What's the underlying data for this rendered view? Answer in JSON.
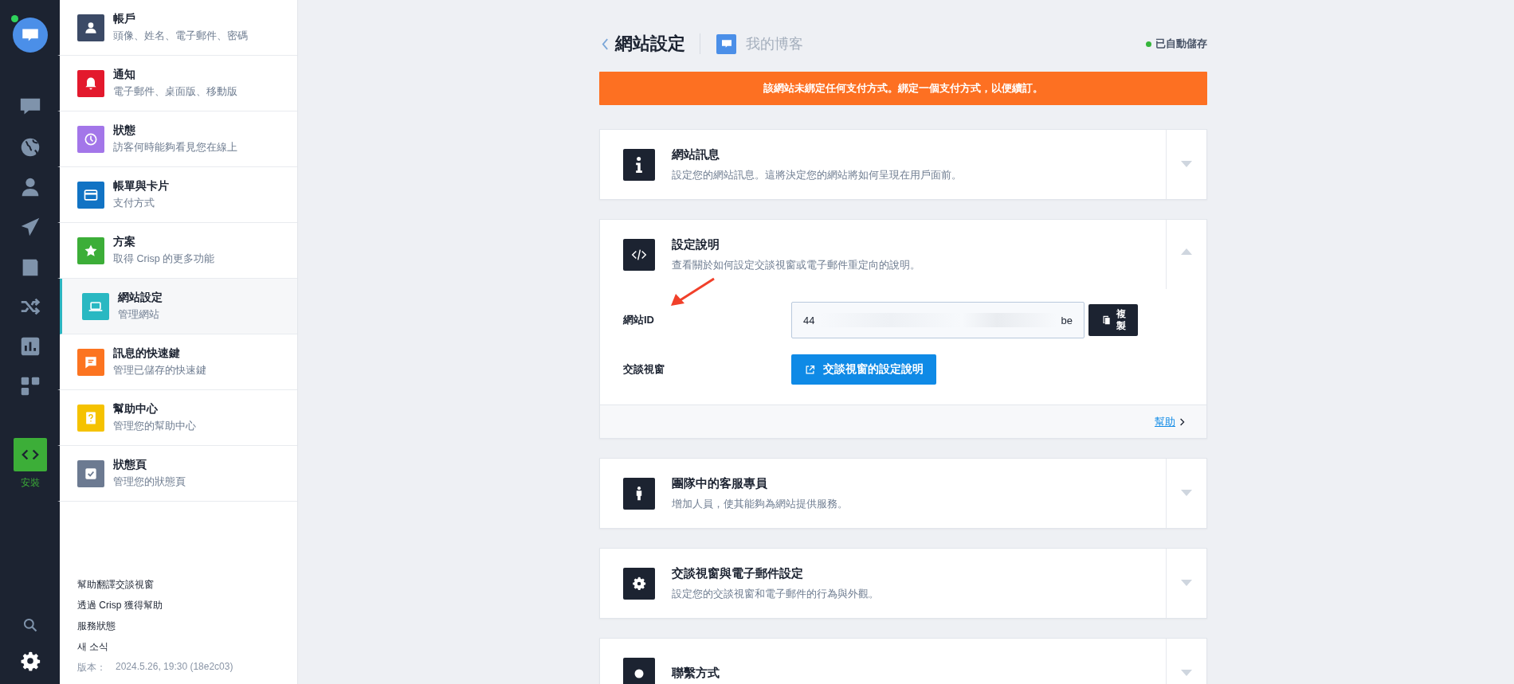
{
  "nav_rail": {
    "items": [
      {
        "selected": false
      },
      {
        "selected": false
      },
      {
        "selected": false
      },
      {
        "selected": false
      },
      {
        "selected": false
      },
      {
        "selected": false
      },
      {
        "selected": false
      },
      {
        "selected": false
      }
    ],
    "install": {
      "label": "安裝",
      "selected": true
    }
  },
  "settings_menu": {
    "items": [
      {
        "title": "帳戶",
        "subtitle": "頭像、姓名、電子郵件、密碼",
        "color": "#3b4a66",
        "selected": false
      },
      {
        "title": "通知",
        "subtitle": "電子郵件、桌面版、移動版",
        "color": "#e3192d",
        "selected": false
      },
      {
        "title": "狀態",
        "subtitle": "訪客何時能夠看見您在線上",
        "color": "#a376e9",
        "selected": false
      },
      {
        "title": "帳單與卡片",
        "subtitle": "支付方式",
        "color": "#1173c4",
        "selected": false
      },
      {
        "title": "方案",
        "subtitle": "取得 Crisp 的更多功能",
        "color": "#3cae38",
        "selected": false
      },
      {
        "title": "網站設定",
        "subtitle": "管理網站",
        "color": "#29b8c2",
        "selected": true
      },
      {
        "title": "訊息的快速鍵",
        "subtitle": "管理已儲存的快速鍵",
        "color": "#fc7420",
        "selected": false
      },
      {
        "title": "幫助中心",
        "subtitle": "管理您的幫助中心",
        "color": "#f5c200",
        "selected": false
      },
      {
        "title": "狀態頁",
        "subtitle": "管理您的狀態頁",
        "color": "#6c7a91",
        "selected": false
      }
    ],
    "links": [
      "幫助翻譯交談視窗",
      "透過 Crisp 獲得幫助",
      "服務狀態",
      "새 소식"
    ],
    "version_label": "版本：",
    "version": "2024.5.26, 19:30 (18e2c03)"
  },
  "header": {
    "title": "網站設定",
    "website": "我的博客",
    "save_status": "已自動儲存"
  },
  "alert": "該網站未綁定任何支付方式。綁定一個支付方式，以便續訂。",
  "cards": [
    {
      "title": "網站訊息",
      "description": "設定您的網站訊息。這將決定您的網站將如何呈現在用戶面前。",
      "expanded": false
    },
    {
      "title": "設定說明",
      "description": "查看關於如何設定交談視窗或電子郵件重定向的說明。",
      "expanded": true,
      "fields": [
        {
          "kind": "id",
          "label": "網站ID",
          "value_start": "44",
          "value_end": "be",
          "button": "複製"
        },
        {
          "kind": "link",
          "label": "交談視窗",
          "button": "交談視窗的設定說明"
        }
      ],
      "help_link": "幫助"
    },
    {
      "title": "團隊中的客服專員",
      "description": "增加人員，使其能夠為網站提供服務。",
      "expanded": false
    },
    {
      "title": "交談視窗與電子郵件設定",
      "description": "設定您的交談視窗和電子郵件的行為與外觀。",
      "expanded": false
    },
    {
      "title": "聯繫方式",
      "expanded": false
    }
  ]
}
